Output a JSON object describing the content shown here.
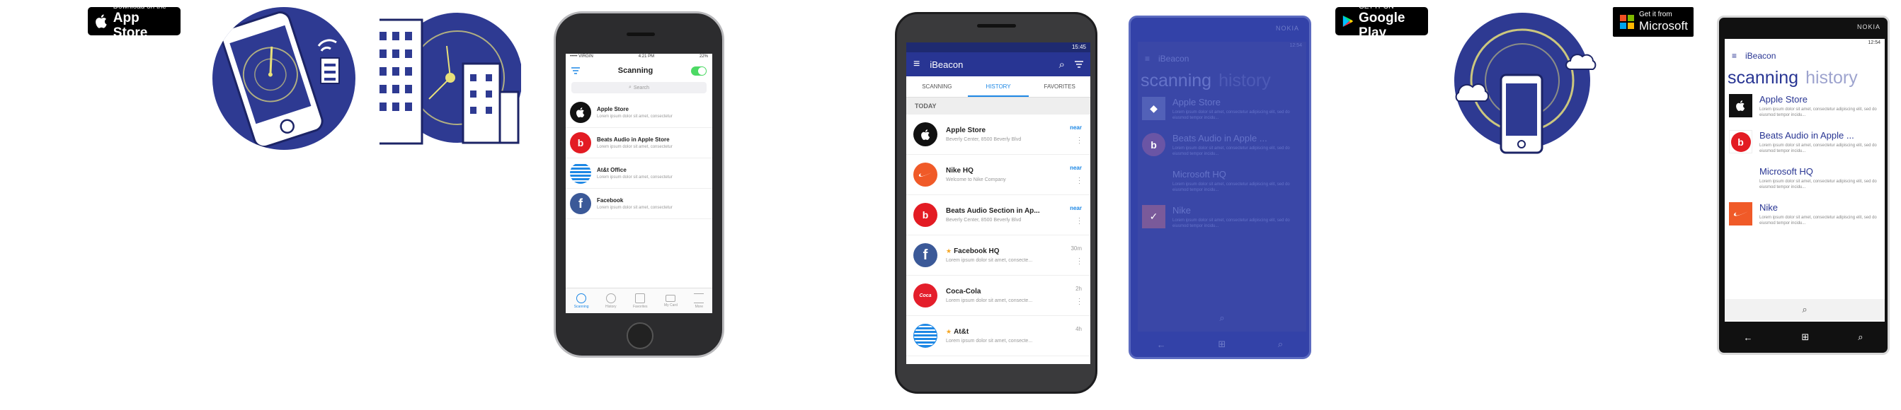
{
  "badges": {
    "appstore": {
      "small": "Download on the",
      "big": "App Store"
    },
    "googleplay": {
      "small": "GET IT ON",
      "big": "Google Play"
    },
    "microsoft": {
      "small": "Get it from",
      "big": "Microsoft"
    }
  },
  "ios": {
    "carrier": "••••• VIRGIN",
    "time": "4:21 PM",
    "battery": "22%",
    "title": "Scanning",
    "search_placeholder": "Search",
    "items": [
      {
        "title": "Apple Store",
        "subtitle": "Lorem ipsum dolor sit amet, consectetur"
      },
      {
        "title": "Beats Audio in Apple Store",
        "subtitle": "Lorem ipsum dolor sit amet, consectetur"
      },
      {
        "title": "At&t Office",
        "subtitle": "Lorem ipsum dolor sit amet, consectetur"
      },
      {
        "title": "Facebook",
        "subtitle": "Lorem ipsum dolor sit amet, consectetur"
      }
    ],
    "tabs": [
      "Scanning",
      "History",
      "Favorites",
      "My Card",
      "More"
    ]
  },
  "android": {
    "time": "15:45",
    "app_title": "iBeacon",
    "tabs": [
      "SCANNING",
      "HISTORY",
      "FAVORITES"
    ],
    "section": "TODAY",
    "items": [
      {
        "title": "Apple Store",
        "subtitle": "Beverly Center, 8500 Beverly Blvd",
        "proximity": "near"
      },
      {
        "title": "Nike HQ",
        "subtitle": "Welcome to Nike Company",
        "proximity": "near"
      },
      {
        "title": "Beats Audio Section in Ap...",
        "subtitle": "Beverly Center, 8500 Beverly Blvd",
        "proximity": "near"
      },
      {
        "title": "Facebook HQ",
        "subtitle": "Lorem ipsum dolor sit amet, consecte...",
        "proximity": "30m"
      },
      {
        "title": "Coca-Cola",
        "subtitle": "Lorem ipsum dolor sit amet, consecte...",
        "proximity": "2h"
      },
      {
        "title": "At&t",
        "subtitle": "Lorem ipsum dolor sit amet, consecte...",
        "proximity": "4h"
      }
    ]
  },
  "wp_blue": {
    "brand": "NOKIA",
    "time": "12:54",
    "app_title": "iBeacon",
    "pivot_active": "scanning",
    "pivot_next": "history",
    "items": [
      {
        "title": "Apple Store",
        "subtitle": "Lorem ipsum dolor sit amet, consectetur adipiscing elit, sed do eiusmod tempor incidu..."
      },
      {
        "title": "Beats Audio in Apple ...",
        "subtitle": "Lorem ipsum dolor sit amet, consectetur adipiscing elit, sed do eiusmod tempor incidu..."
      },
      {
        "title": "Microsoft HQ",
        "subtitle": "Lorem ipsum dolor sit amet, consectetur adipiscing elit, sed do eiusmod tempor incidu..."
      },
      {
        "title": "Nike",
        "subtitle": "Lorem ipsum dolor sit amet, consectetur adipiscing elit, sed do eiusmod tempor incidu..."
      }
    ]
  },
  "wp_black": {
    "brand": "NOKIA",
    "time": "12:54",
    "app_title": "iBeacon",
    "pivot_active": "scanning",
    "pivot_next": "history",
    "items": [
      {
        "title": "Apple Store",
        "subtitle": "Lorem ipsum dolor sit amet, consectetur adipiscing elit, sed do eiusmod tempor incidu..."
      },
      {
        "title": "Beats Audio in Apple ...",
        "subtitle": "Lorem ipsum dolor sit amet, consectetur adipiscing elit, sed do eiusmod tempor incidu..."
      },
      {
        "title": "Microsoft HQ",
        "subtitle": "Lorem ipsum dolor sit amet, consectetur adipiscing elit, sed do eiusmod tempor incidu..."
      },
      {
        "title": "Nike",
        "subtitle": "Lorem ipsum dolor sit amet, consectetur adipiscing elit, sed do eiusmod tempor incidu..."
      }
    ]
  },
  "colors": {
    "brand_navy": "#2e3a92",
    "accent_yellow": "#e8e07a",
    "android_blue": "#283593",
    "link_blue": "#1e88e5"
  },
  "icons": [
    "apple-icon",
    "beats-icon",
    "att-icon",
    "facebook-icon",
    "nike-icon",
    "coca-cola-icon",
    "microsoft-icon",
    "menu-icon",
    "search-icon",
    "filter-icon",
    "google-play-icon",
    "back-icon",
    "windows-icon"
  ]
}
